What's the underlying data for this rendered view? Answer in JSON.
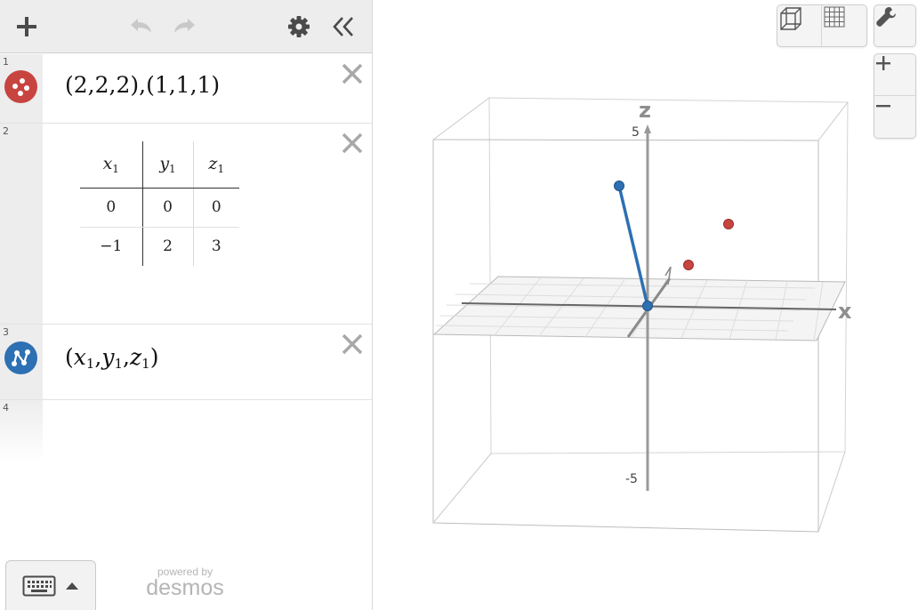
{
  "toolbar": {
    "add_icon": "plus-icon",
    "undo_icon": "undo-icon",
    "redo_icon": "redo-icon",
    "settings_icon": "gear-icon",
    "collapse_icon": "double-chevron-left-icon"
  },
  "expressions": [
    {
      "number": "1",
      "icon": "point-icon",
      "color": "#c74440",
      "latex": "(2,2,2),(1,1,1)"
    },
    {
      "number": "2",
      "type": "table",
      "columns": [
        {
          "var": "x",
          "sub": "1"
        },
        {
          "var": "y",
          "sub": "1"
        },
        {
          "var": "z",
          "sub": "1"
        }
      ],
      "rows": [
        [
          "0",
          "0",
          "0"
        ],
        [
          "−1",
          "2",
          "3"
        ]
      ]
    },
    {
      "number": "3",
      "icon": "connected-points-icon",
      "color": "#2d70b3",
      "parts": {
        "open": "(",
        "x": "x",
        "x_sub": "1",
        "y": "y",
        "y_sub": "1",
        "z": "z",
        "z_sub": "1",
        "close": ")"
      }
    },
    {
      "number": "4"
    }
  ],
  "keyboard_button": {
    "icon": "keyboard-icon",
    "caret_icon": "caret-up-icon"
  },
  "branding": {
    "line1": "powered by",
    "line2": "desmos"
  },
  "graph": {
    "axis_x": "x",
    "axis_z": "z",
    "tick_z_top": "5",
    "tick_z_bottom": "-5",
    "view_buttons": [
      "3d-cube-icon",
      "grid-icon"
    ],
    "settings_button": "wrench-icon",
    "zoom_in": "zoom-in-icon",
    "zoom_out": "zoom-out-icon",
    "point_color": "#c74440",
    "line_color": "#2d70b3"
  }
}
